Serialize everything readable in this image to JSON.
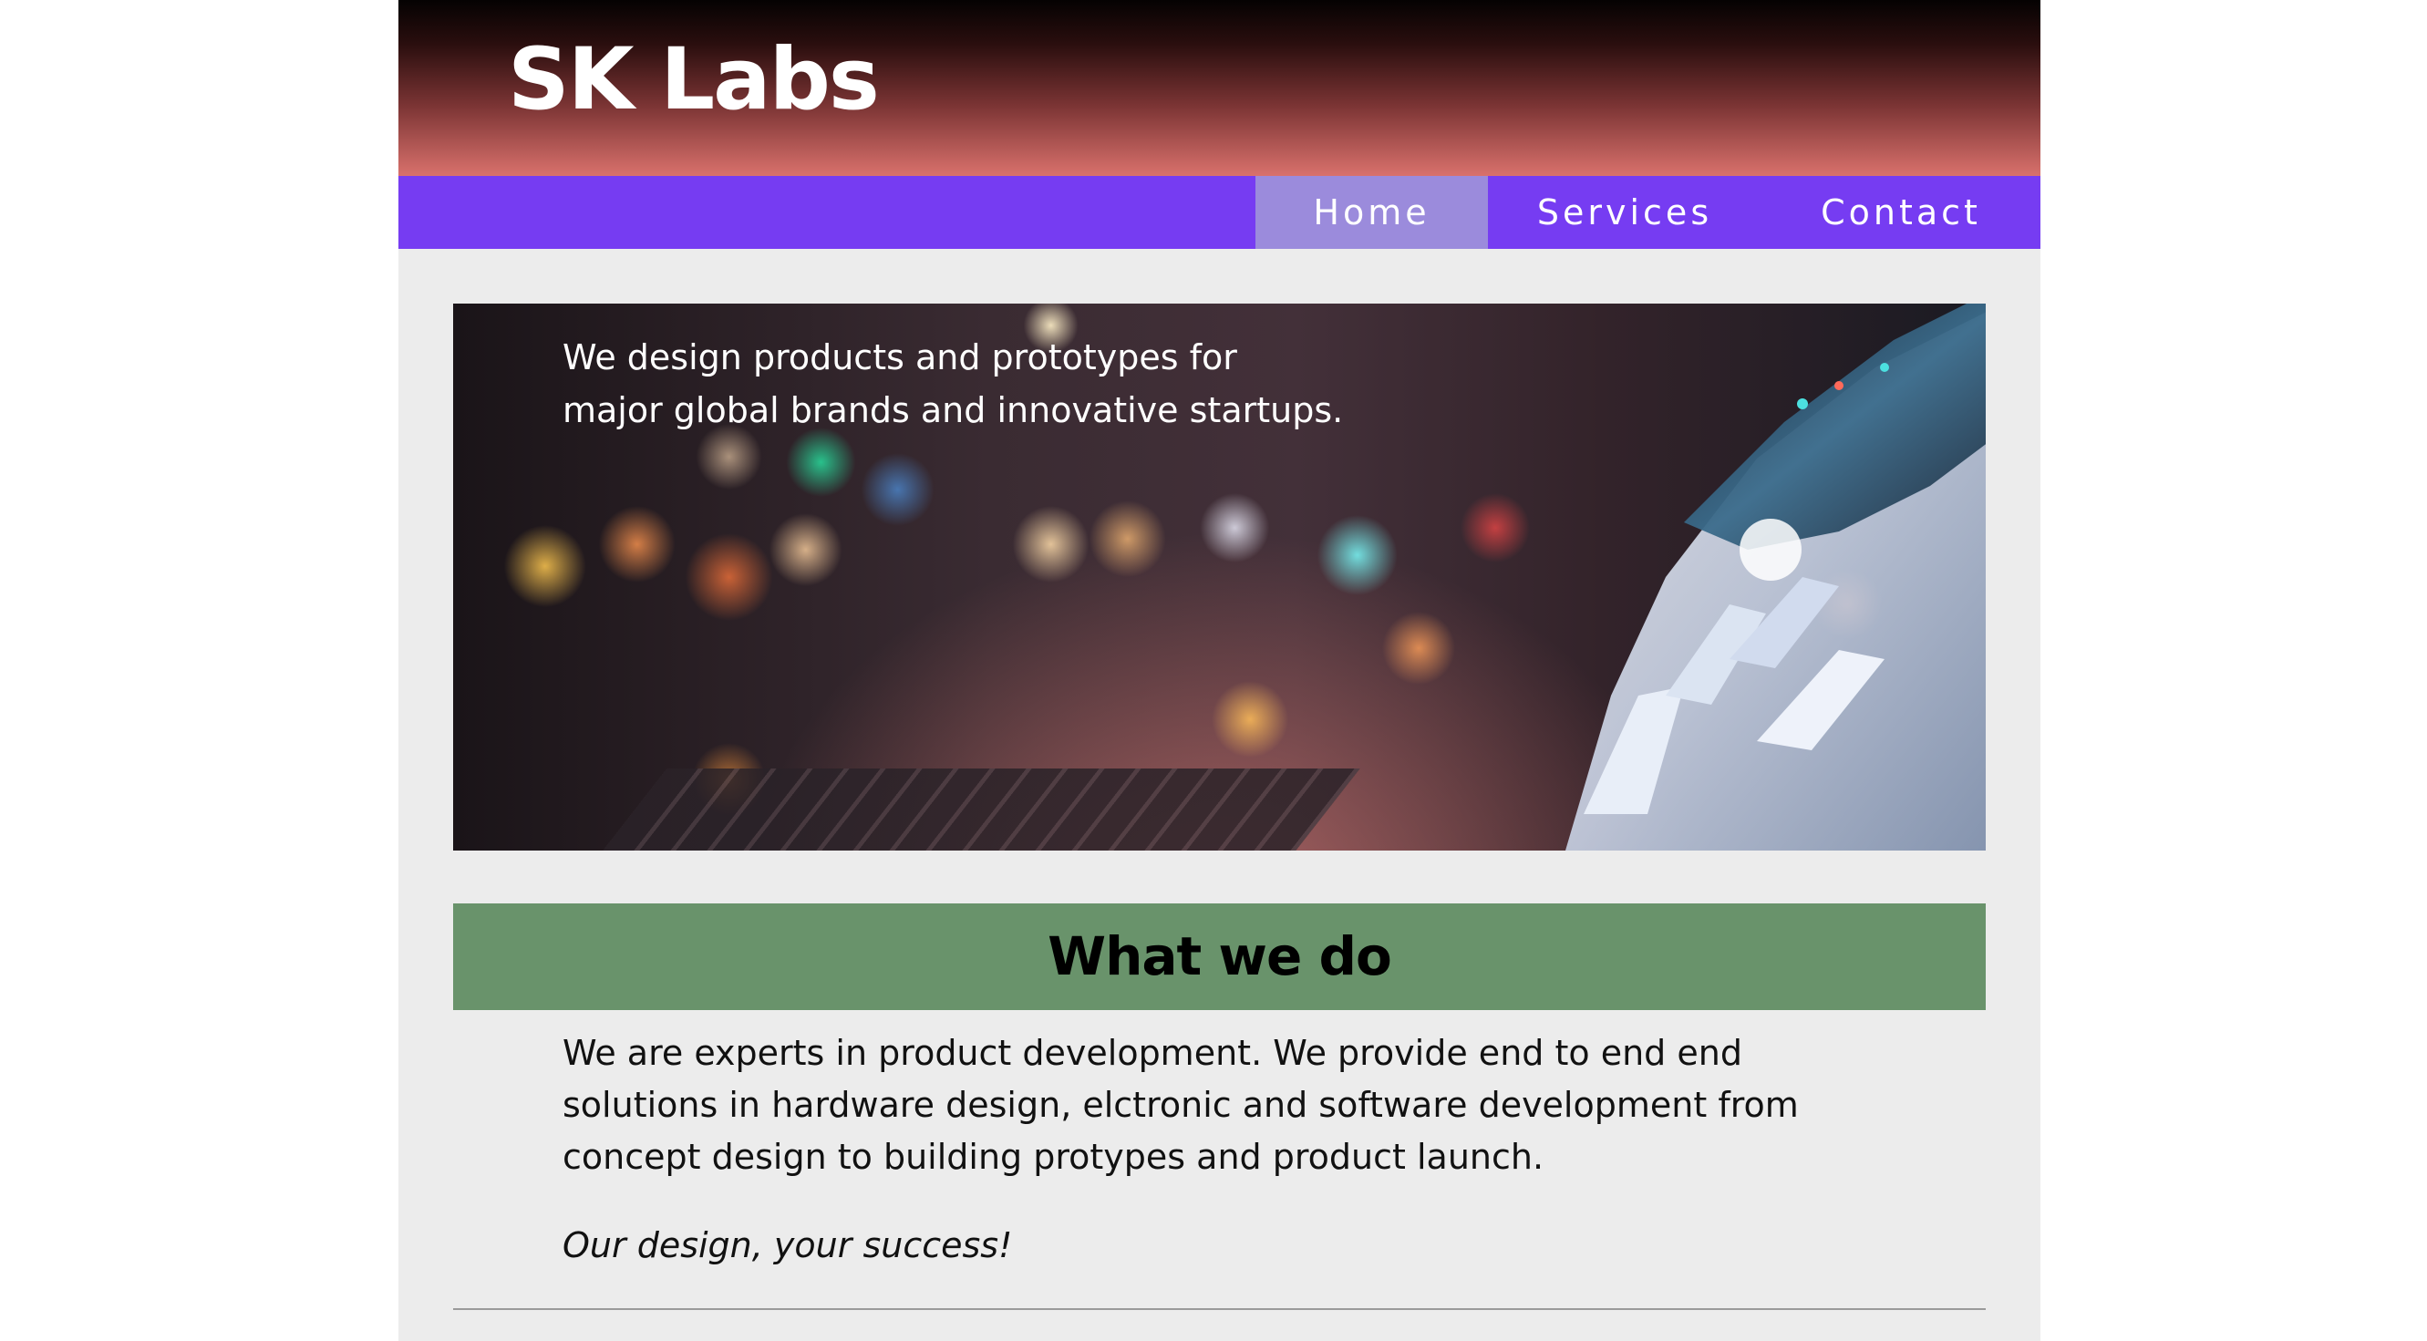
{
  "header": {
    "brand": "SK Labs"
  },
  "nav": {
    "items": [
      {
        "label": "Home",
        "active": true
      },
      {
        "label": "Services",
        "active": false
      },
      {
        "label": "Contact",
        "active": false
      }
    ]
  },
  "hero": {
    "text_line1": "We design products and prototypes for",
    "text_line2": "major global brands and innovative startups.",
    "image": "robot-hand-laptop-bokeh"
  },
  "section": {
    "title": "What we do",
    "body_line1": "We are experts in product development. We provide end to end end",
    "body_line2": "solutions in hardware design, elctronic and software development from",
    "body_line3": "concept design to building protypes and product launch.",
    "tagline": "Our design, your success!"
  },
  "colors": {
    "nav_bg": "#763cf2",
    "nav_active_bg": "#9b8bdc",
    "section_bar_bg": "#69936b",
    "page_bg": "#ececec",
    "header_gradient_bottom": "#d9716c"
  }
}
